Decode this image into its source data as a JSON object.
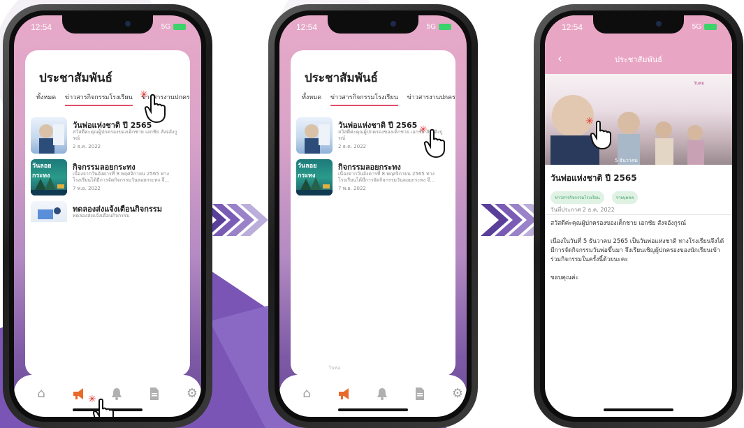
{
  "colors": {
    "accent": "#e86a2a",
    "tab_underline": "#e0506a",
    "chip_bg": "#dff2e4",
    "chip_text": "#44a368",
    "header_pink": "#e9a6c4"
  },
  "status_bar": {
    "time": "12:54",
    "network": "5G"
  },
  "list_screen": {
    "title": "ประชาสัมพันธ์",
    "tabs": [
      "ทั้งหมด",
      "ข่าวสารกิจกรรมโรงเรียน",
      "ข่าวสารงานปกครอง"
    ],
    "active_tab_index": 1,
    "items": [
      {
        "title": "วันพ่อแห่งชาติ ปี 2565",
        "desc": "สวัสดีค่ะคุณผู้ปกครองของเด็กชาย เอกชัย สังจอังกูรณ์",
        "date": "2 ธ.ค. 2022",
        "thumb_label": ""
      },
      {
        "title": "กิจกรรมลอยกระทง",
        "desc": "เนื่องจากวันอังคารที่ 8 พฤศจิกายน 2565 ทางโรงเรียนได้มีการจัดกิจกรรมวันลอยกระทง จึ...",
        "date": "7 พ.ย. 2022",
        "thumb_label": "วันลอยกระทง"
      },
      {
        "title": "ทดลองส่งแจ้งเตือนกิจกรรม",
        "desc": "ทดลองส่งแจ้งเตือนกิจกรรม",
        "date": "",
        "thumb_label": ""
      }
    ],
    "faded_item": "วันพ่อ"
  },
  "nav_icons": [
    "home-icon",
    "megaphone-icon",
    "bell-icon",
    "document-icon",
    "gear-icon"
  ],
  "detail_screen": {
    "header_title": "ประชาสัมพันธ์",
    "back_glyph": "‹",
    "hero_caption": "วันพ่อ",
    "hero_bottom_text": "5 ธันวาคม",
    "title": "วันพ่อแห่งชาติ ปี 2565",
    "chips": [
      "ข่าวสารกิจกรรมโรงเรียน",
      "รายบุคคล"
    ],
    "date": "วันที่ประกาศ 2 ธ.ค. 2022",
    "body": [
      "สวัสดีค่ะคุณผู้ปกครองของเด็กชาย เอกชัย สังจอังกูรณ์",
      "เนื่องในวันที่ 5 ธันวาคม 2565 เป็นวันพ่อแห่งชาติ ทางโรงเรียนจึงได้มีการจัดกิจกรรมวันพ่อขึ้นมา จึงเรียนเชิญผู้ปกครองของนักเรียนเข้าร่วมกิจกรรมในครั้งนี้ด้วยนะคะ",
      "ขอบคุณค่ะ"
    ]
  }
}
